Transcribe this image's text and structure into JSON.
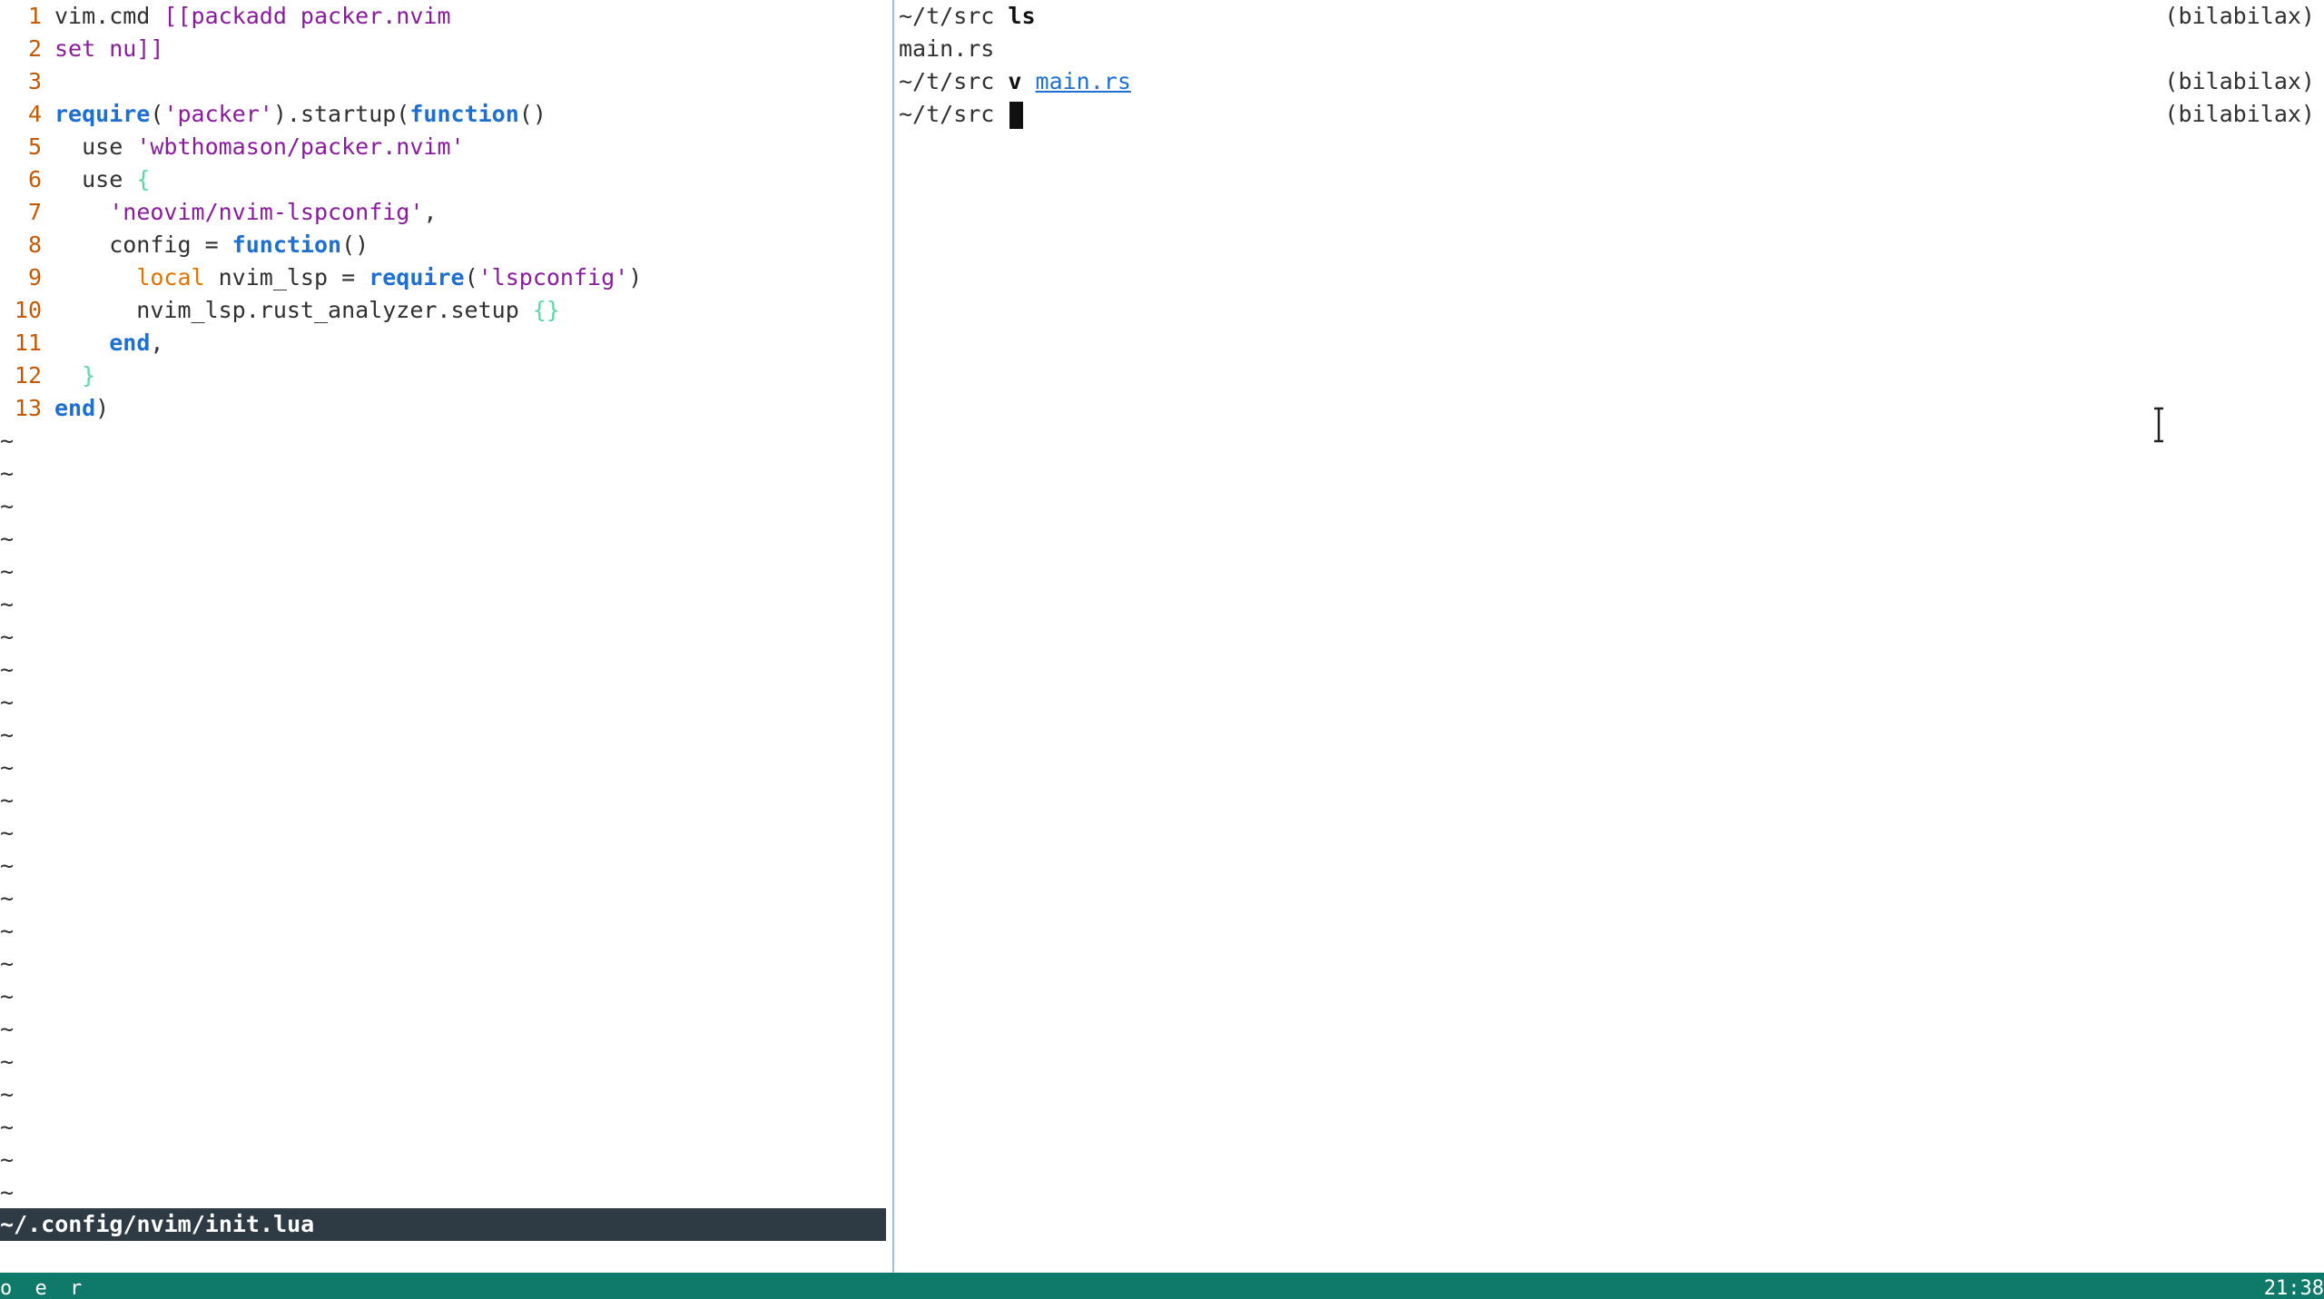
{
  "editor": {
    "lines": [
      {
        "num": "1",
        "tokens": [
          {
            "t": "vim.cmd ",
            "c": "plain"
          },
          {
            "t": "[[packadd packer.nvim",
            "c": "str"
          }
        ]
      },
      {
        "num": "2",
        "tokens": [
          {
            "t": "set nu]]",
            "c": "str"
          }
        ]
      },
      {
        "num": "3",
        "tokens": []
      },
      {
        "num": "4",
        "tokens": [
          {
            "t": "require",
            "c": "kw"
          },
          {
            "t": "(",
            "c": "plain"
          },
          {
            "t": "'packer'",
            "c": "str"
          },
          {
            "t": ").startup(",
            "c": "plain"
          },
          {
            "t": "function",
            "c": "kw"
          },
          {
            "t": "()",
            "c": "plain"
          }
        ]
      },
      {
        "num": "5",
        "tokens": [
          {
            "t": "  use ",
            "c": "plain"
          },
          {
            "t": "'wbthomason/packer.nvim'",
            "c": "str"
          }
        ]
      },
      {
        "num": "6",
        "tokens": [
          {
            "t": "  use ",
            "c": "plain"
          },
          {
            "t": "{",
            "c": "brace"
          }
        ]
      },
      {
        "num": "7",
        "tokens": [
          {
            "t": "    ",
            "c": "plain"
          },
          {
            "t": "'neovim/nvim-lspconfig'",
            "c": "str"
          },
          {
            "t": ",",
            "c": "plain"
          }
        ]
      },
      {
        "num": "8",
        "tokens": [
          {
            "t": "    config = ",
            "c": "plain"
          },
          {
            "t": "function",
            "c": "kw"
          },
          {
            "t": "()",
            "c": "plain"
          }
        ]
      },
      {
        "num": "9",
        "tokens": [
          {
            "t": "      ",
            "c": "plain"
          },
          {
            "t": "local",
            "c": "local"
          },
          {
            "t": " nvim_lsp = ",
            "c": "plain"
          },
          {
            "t": "require",
            "c": "kw"
          },
          {
            "t": "(",
            "c": "plain"
          },
          {
            "t": "'lspconfig'",
            "c": "str"
          },
          {
            "t": ")",
            "c": "plain"
          }
        ]
      },
      {
        "num": "10",
        "tokens": [
          {
            "t": "      nvim_lsp.rust_analyzer.setup ",
            "c": "plain"
          },
          {
            "t": "{}",
            "c": "brace"
          }
        ]
      },
      {
        "num": "11",
        "tokens": [
          {
            "t": "    ",
            "c": "plain"
          },
          {
            "t": "end",
            "c": "kw"
          },
          {
            "t": ",",
            "c": "plain"
          }
        ]
      },
      {
        "num": "12",
        "tokens": [
          {
            "t": "  ",
            "c": "plain"
          },
          {
            "t": "}",
            "c": "brace"
          }
        ]
      },
      {
        "num": "13",
        "tokens": [
          {
            "t": "end",
            "c": "kw"
          },
          {
            "t": ")",
            "c": "plain"
          }
        ]
      }
    ],
    "tilde": "~",
    "tilde_count": 24,
    "statusline": "~/.config/nvim/init.lua"
  },
  "shell": {
    "host": "(bilabilax)",
    "lines": [
      {
        "prompt": "~/t/src ",
        "cmd": "ls",
        "arg": "",
        "show_host": true,
        "cursor": false
      },
      {
        "prompt": "main.rs",
        "cmd": "",
        "arg": "",
        "show_host": false,
        "cursor": false
      },
      {
        "prompt": "~/t/src ",
        "cmd": "v ",
        "arg": "main.rs",
        "show_host": true,
        "cursor": false
      },
      {
        "prompt": "~/t/src ",
        "cmd": "",
        "arg": "",
        "show_host": true,
        "cursor": true
      }
    ]
  },
  "tmux": {
    "left": "o e r",
    "right": "21:38"
  }
}
